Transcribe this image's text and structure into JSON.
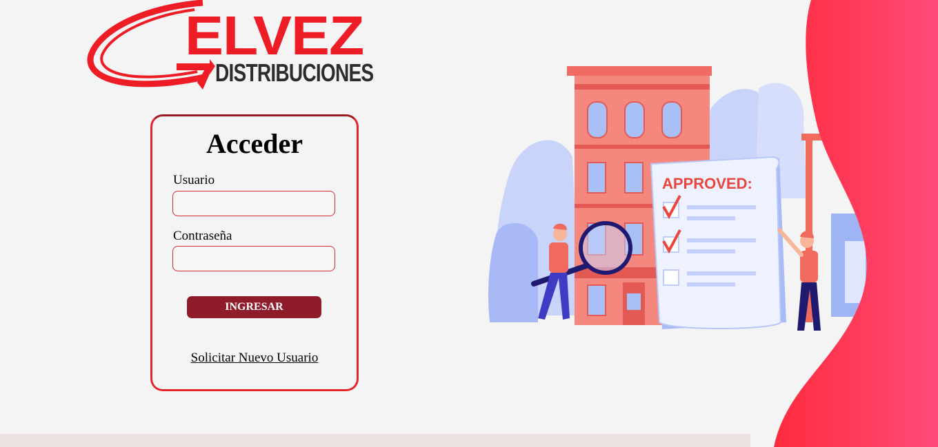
{
  "brand": {
    "name": "ELVEZ",
    "subtitle": "DISTRIBUCIONES"
  },
  "login": {
    "title": "Acceder",
    "username_label": "Usuario",
    "username_value": "",
    "password_label": "Contraseña",
    "password_value": "",
    "submit_label": "INGRESAR",
    "request_link": "Solicitar Nuevo Usuario"
  },
  "illustration": {
    "document_heading": "APPROVED:"
  },
  "colors": {
    "brand_red": "#ee1c25",
    "button": "#8e1c2a",
    "card_border": "#e3262b",
    "wave_start": "#ff2b3e",
    "wave_end": "#ff4b79"
  },
  "icons": {
    "swoosh": "swoosh-arrow-icon",
    "magnifier": "magnifier-icon",
    "checkmark": "checkmark-icon"
  }
}
